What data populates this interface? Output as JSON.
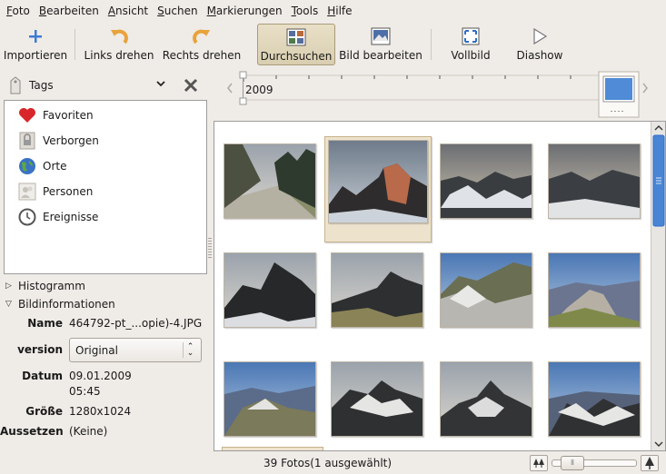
{
  "menubar": {
    "items": [
      {
        "mn": "F",
        "rest": "oto"
      },
      {
        "mn": "B",
        "rest": "earbeiten"
      },
      {
        "mn": "A",
        "rest": "nsicht"
      },
      {
        "mn": "S",
        "rest": "uchen"
      },
      {
        "mn": "M",
        "rest": "arkierungen"
      },
      {
        "mn": "T",
        "rest": "ools"
      },
      {
        "mn": "H",
        "rest": "ilfe"
      }
    ]
  },
  "toolbar": {
    "import": "Importieren",
    "rotate_left": "Links drehen",
    "rotate_right": "Rechts drehen",
    "browse": "Durchsuchen",
    "edit": "Bild bearbeiten",
    "fullscreen": "Vollbild",
    "slideshow": "Diashow"
  },
  "tags": {
    "header": "Tags",
    "items": [
      {
        "label": "Favoriten",
        "icon": "heart-icon"
      },
      {
        "label": "Verborgen",
        "icon": "lock-icon"
      },
      {
        "label": "Orte",
        "icon": "globe-icon"
      },
      {
        "label": "Personen",
        "icon": "people-icon"
      },
      {
        "label": "Ereignisse",
        "icon": "clock-icon"
      }
    ]
  },
  "sections": {
    "histogram": "Histogramm",
    "image_info": "Bildinformationen"
  },
  "info": {
    "name_label": "Name",
    "name_value": "464792-pt_...opie)-4.JPG",
    "version_label": "version",
    "version_value": "Original",
    "date_label": "Datum",
    "date_value": "09.01.2009",
    "time_value": "05:45",
    "size_label": "Größe",
    "size_value": "1280x1024",
    "exposure_label": "Aussetzen",
    "exposure_value": "(Keine)"
  },
  "timeline": {
    "year": "2009"
  },
  "status": {
    "text": "39 Fotos(1 ausgewählt)",
    "zoom_level": 0.1
  },
  "colors": {
    "selected": "#ede3cd",
    "accent": "#2e6ec9"
  }
}
